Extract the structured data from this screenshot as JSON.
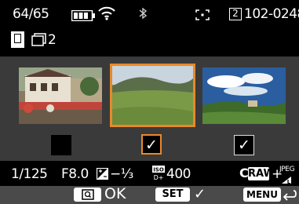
{
  "status": {
    "shot_count": "64/65",
    "card_info": "2 102-0248",
    "card_slot": "2",
    "folder_file": "102-0248"
  },
  "view": {
    "copies_label": "2"
  },
  "thumbnails": [
    {
      "name": "building-photo",
      "selected": false,
      "checked": false
    },
    {
      "name": "meadow-photo",
      "selected": true,
      "checked": true
    },
    {
      "name": "sky-landscape-photo",
      "selected": false,
      "checked": true
    }
  ],
  "check_symbol": "✓",
  "exposure": {
    "shutter": "1/125",
    "aperture": "F8.0",
    "exp_comp": "−⅓",
    "iso_value": "400",
    "raw_label": "RAW",
    "plus": "+",
    "jpeg_label": "JPEG"
  },
  "footer": {
    "ok_label": "OK",
    "set_label": "SET",
    "menu_label": "MENU"
  },
  "colors": {
    "accent": "#e8892a",
    "midband": "#3a3a3a"
  }
}
